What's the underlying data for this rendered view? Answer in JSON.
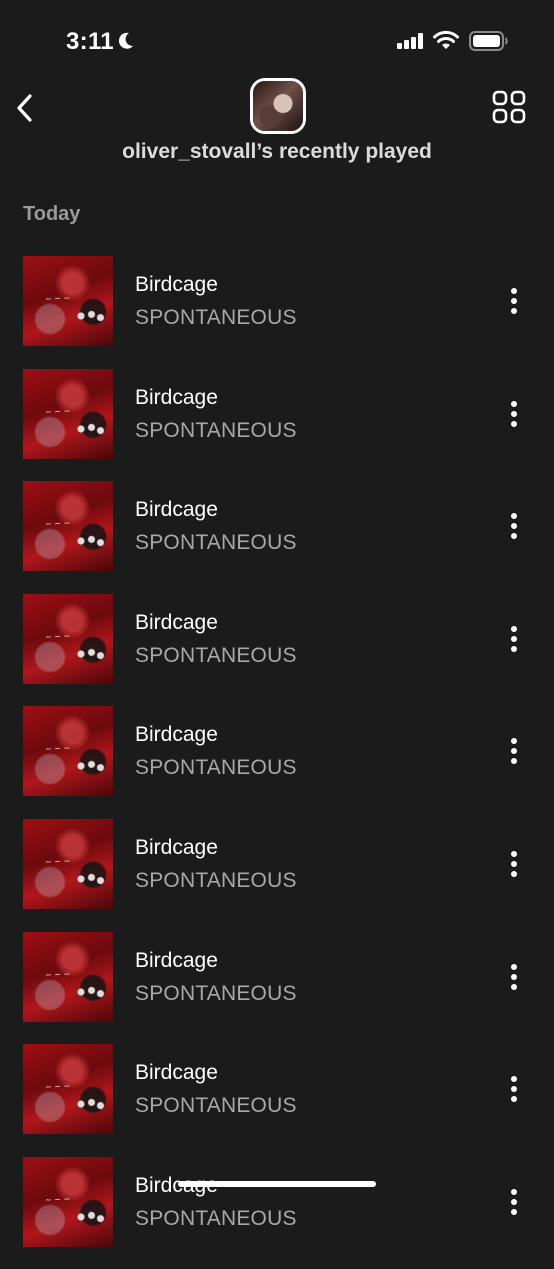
{
  "status_bar": {
    "time": "3:11",
    "icons": [
      "moon-icon",
      "cellular-signal-icon",
      "wifi-icon",
      "battery-icon"
    ]
  },
  "header": {
    "back_icon": "chevron-left-icon",
    "grid_icon": "grid-icon",
    "title": "oliver_stovall’s recently played"
  },
  "section": {
    "label": "Today"
  },
  "tracks": [
    {
      "title": "Birdcage",
      "artist": "SPONTANEOUS"
    },
    {
      "title": "Birdcage",
      "artist": "SPONTANEOUS"
    },
    {
      "title": "Birdcage",
      "artist": "SPONTANEOUS"
    },
    {
      "title": "Birdcage",
      "artist": "SPONTANEOUS"
    },
    {
      "title": "Birdcage",
      "artist": "SPONTANEOUS"
    },
    {
      "title": "Birdcage",
      "artist": "SPONTANEOUS"
    },
    {
      "title": "Birdcage",
      "artist": "SPONTANEOUS"
    },
    {
      "title": "Birdcage",
      "artist": "SPONTANEOUS"
    },
    {
      "title": "Birdcage",
      "artist": "SPONTANEOUS"
    }
  ],
  "colors": {
    "background": "#1b1b1b",
    "text_primary": "#ffffff",
    "text_secondary": "#a8a8a8",
    "cover_red": "#9c0f14"
  }
}
